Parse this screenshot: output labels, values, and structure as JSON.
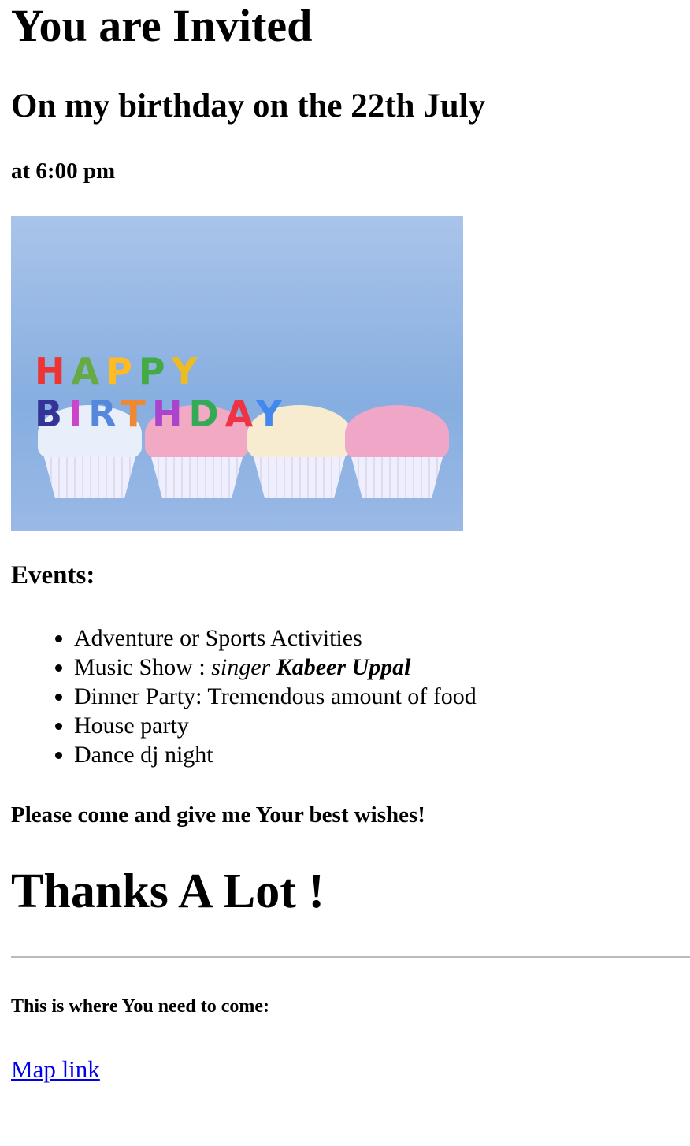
{
  "title": "You are Invited",
  "subtitle": "On my birthday on the 22th July",
  "time": "at 6:00 pm",
  "image": {
    "alt": "Happy Birthday cupcakes",
    "letters": "HAPPY BIRTHDAY"
  },
  "events_heading": "Events:",
  "events": [
    {
      "text": "Adventure or Sports Activities"
    },
    {
      "text": "Music Show : ",
      "em": "singer ",
      "strong": "Kabeer Uppal"
    },
    {
      "text": "Dinner Party: Tremendous amount of food"
    },
    {
      "text": "House party"
    },
    {
      "text": "Dance dj night"
    }
  ],
  "wishes": "Please come and give me Your best wishes!",
  "thanks": "Thanks A Lot !",
  "location_label": "This is where You need to come:",
  "map_link": "Map link"
}
